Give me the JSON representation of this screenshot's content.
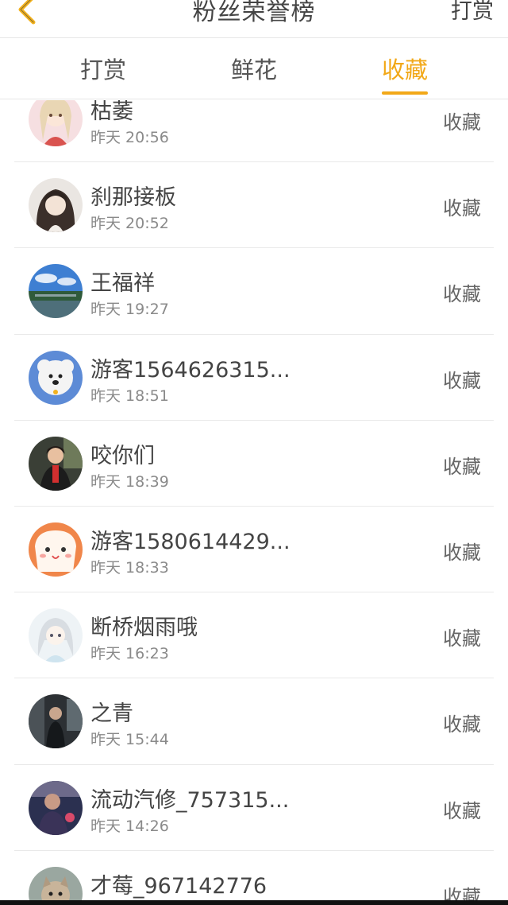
{
  "header": {
    "title": "粉丝荣誉榜",
    "right_link": "打赏"
  },
  "tabs": [
    {
      "label": "打赏"
    },
    {
      "label": "鲜花"
    },
    {
      "label": "收藏"
    }
  ],
  "entries": [
    {
      "name": "枯萎",
      "time": "昨天 20:56",
      "action": "收藏"
    },
    {
      "name": "刹那接板",
      "time": "昨天 20:52",
      "action": "收藏"
    },
    {
      "name": "王福祥",
      "time": "昨天 19:27",
      "action": "收藏"
    },
    {
      "name": "游客1564626315...",
      "time": "昨天 18:51",
      "action": "收藏"
    },
    {
      "name": "咬你们",
      "time": "昨天 18:39",
      "action": "收藏"
    },
    {
      "name": "游客1580614429...",
      "time": "昨天 18:33",
      "action": "收藏"
    },
    {
      "name": "断桥烟雨哦",
      "time": "昨天 16:23",
      "action": "收藏"
    },
    {
      "name": "之青",
      "time": "昨天 15:44",
      "action": "收藏"
    },
    {
      "name": "流动汽修_757315...",
      "time": "昨天 14:26",
      "action": "收藏"
    },
    {
      "name": "才莓_967142776",
      "time": "",
      "action": "收藏"
    }
  ],
  "colors": {
    "accent": "#f2a818",
    "text": "#444444",
    "muted": "#8a8a8a"
  }
}
